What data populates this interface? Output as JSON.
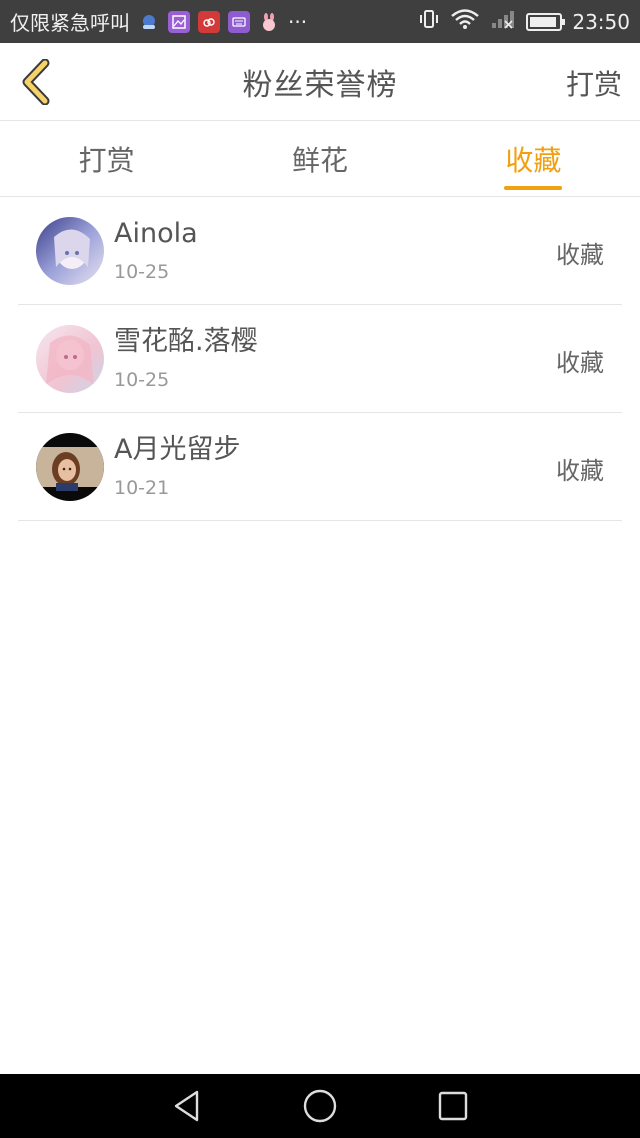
{
  "status_bar": {
    "carrier_text": "仅限紧急呼叫",
    "more_glyph": "···",
    "time": "23:50",
    "battery_level": 0.9,
    "notification_icons": [
      "notification-app-icon",
      "gallery-icon",
      "cloud-icon",
      "keyboard-icon",
      "bunny-icon"
    ]
  },
  "header": {
    "title": "粉丝荣誉榜",
    "action_label": "打赏",
    "back_icon": "chevron-left-icon"
  },
  "tabs": [
    {
      "label": "打赏",
      "active": false
    },
    {
      "label": "鲜花",
      "active": false
    },
    {
      "label": "收藏",
      "active": true
    }
  ],
  "list": [
    {
      "name": "Ainola",
      "date": "10-25",
      "action": "收藏"
    },
    {
      "name": "雪花酩.落樱",
      "date": "10-25",
      "action": "收藏"
    },
    {
      "name": "A月光留步",
      "date": "10-21",
      "action": "收藏"
    }
  ],
  "colors": {
    "accent": "#f0a010",
    "status_bar_bg": "#3f3f3f",
    "nav_bar_bg": "#000000",
    "divider": "#e6e6e6"
  },
  "nav_bar": {
    "icons": [
      "back-triangle-icon",
      "home-circle-icon",
      "recents-square-icon"
    ]
  }
}
